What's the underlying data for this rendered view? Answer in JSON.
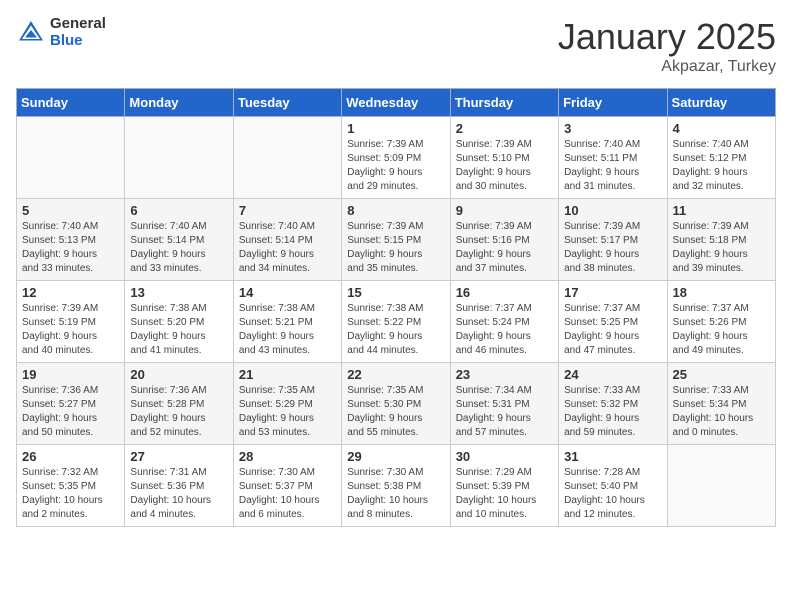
{
  "logo": {
    "general": "General",
    "blue": "Blue"
  },
  "header": {
    "title": "January 2025",
    "subtitle": "Akpazar, Turkey"
  },
  "days_of_week": [
    "Sunday",
    "Monday",
    "Tuesday",
    "Wednesday",
    "Thursday",
    "Friday",
    "Saturday"
  ],
  "weeks": [
    [
      {
        "day": "",
        "info": ""
      },
      {
        "day": "",
        "info": ""
      },
      {
        "day": "",
        "info": ""
      },
      {
        "day": "1",
        "info": "Sunrise: 7:39 AM\nSunset: 5:09 PM\nDaylight: 9 hours\nand 29 minutes."
      },
      {
        "day": "2",
        "info": "Sunrise: 7:39 AM\nSunset: 5:10 PM\nDaylight: 9 hours\nand 30 minutes."
      },
      {
        "day": "3",
        "info": "Sunrise: 7:40 AM\nSunset: 5:11 PM\nDaylight: 9 hours\nand 31 minutes."
      },
      {
        "day": "4",
        "info": "Sunrise: 7:40 AM\nSunset: 5:12 PM\nDaylight: 9 hours\nand 32 minutes."
      }
    ],
    [
      {
        "day": "5",
        "info": "Sunrise: 7:40 AM\nSunset: 5:13 PM\nDaylight: 9 hours\nand 33 minutes."
      },
      {
        "day": "6",
        "info": "Sunrise: 7:40 AM\nSunset: 5:14 PM\nDaylight: 9 hours\nand 33 minutes."
      },
      {
        "day": "7",
        "info": "Sunrise: 7:40 AM\nSunset: 5:14 PM\nDaylight: 9 hours\nand 34 minutes."
      },
      {
        "day": "8",
        "info": "Sunrise: 7:39 AM\nSunset: 5:15 PM\nDaylight: 9 hours\nand 35 minutes."
      },
      {
        "day": "9",
        "info": "Sunrise: 7:39 AM\nSunset: 5:16 PM\nDaylight: 9 hours\nand 37 minutes."
      },
      {
        "day": "10",
        "info": "Sunrise: 7:39 AM\nSunset: 5:17 PM\nDaylight: 9 hours\nand 38 minutes."
      },
      {
        "day": "11",
        "info": "Sunrise: 7:39 AM\nSunset: 5:18 PM\nDaylight: 9 hours\nand 39 minutes."
      }
    ],
    [
      {
        "day": "12",
        "info": "Sunrise: 7:39 AM\nSunset: 5:19 PM\nDaylight: 9 hours\nand 40 minutes."
      },
      {
        "day": "13",
        "info": "Sunrise: 7:38 AM\nSunset: 5:20 PM\nDaylight: 9 hours\nand 41 minutes."
      },
      {
        "day": "14",
        "info": "Sunrise: 7:38 AM\nSunset: 5:21 PM\nDaylight: 9 hours\nand 43 minutes."
      },
      {
        "day": "15",
        "info": "Sunrise: 7:38 AM\nSunset: 5:22 PM\nDaylight: 9 hours\nand 44 minutes."
      },
      {
        "day": "16",
        "info": "Sunrise: 7:37 AM\nSunset: 5:24 PM\nDaylight: 9 hours\nand 46 minutes."
      },
      {
        "day": "17",
        "info": "Sunrise: 7:37 AM\nSunset: 5:25 PM\nDaylight: 9 hours\nand 47 minutes."
      },
      {
        "day": "18",
        "info": "Sunrise: 7:37 AM\nSunset: 5:26 PM\nDaylight: 9 hours\nand 49 minutes."
      }
    ],
    [
      {
        "day": "19",
        "info": "Sunrise: 7:36 AM\nSunset: 5:27 PM\nDaylight: 9 hours\nand 50 minutes."
      },
      {
        "day": "20",
        "info": "Sunrise: 7:36 AM\nSunset: 5:28 PM\nDaylight: 9 hours\nand 52 minutes."
      },
      {
        "day": "21",
        "info": "Sunrise: 7:35 AM\nSunset: 5:29 PM\nDaylight: 9 hours\nand 53 minutes."
      },
      {
        "day": "22",
        "info": "Sunrise: 7:35 AM\nSunset: 5:30 PM\nDaylight: 9 hours\nand 55 minutes."
      },
      {
        "day": "23",
        "info": "Sunrise: 7:34 AM\nSunset: 5:31 PM\nDaylight: 9 hours\nand 57 minutes."
      },
      {
        "day": "24",
        "info": "Sunrise: 7:33 AM\nSunset: 5:32 PM\nDaylight: 9 hours\nand 59 minutes."
      },
      {
        "day": "25",
        "info": "Sunrise: 7:33 AM\nSunset: 5:34 PM\nDaylight: 10 hours\nand 0 minutes."
      }
    ],
    [
      {
        "day": "26",
        "info": "Sunrise: 7:32 AM\nSunset: 5:35 PM\nDaylight: 10 hours\nand 2 minutes."
      },
      {
        "day": "27",
        "info": "Sunrise: 7:31 AM\nSunset: 5:36 PM\nDaylight: 10 hours\nand 4 minutes."
      },
      {
        "day": "28",
        "info": "Sunrise: 7:30 AM\nSunset: 5:37 PM\nDaylight: 10 hours\nand 6 minutes."
      },
      {
        "day": "29",
        "info": "Sunrise: 7:30 AM\nSunset: 5:38 PM\nDaylight: 10 hours\nand 8 minutes."
      },
      {
        "day": "30",
        "info": "Sunrise: 7:29 AM\nSunset: 5:39 PM\nDaylight: 10 hours\nand 10 minutes."
      },
      {
        "day": "31",
        "info": "Sunrise: 7:28 AM\nSunset: 5:40 PM\nDaylight: 10 hours\nand 12 minutes."
      },
      {
        "day": "",
        "info": ""
      }
    ]
  ]
}
